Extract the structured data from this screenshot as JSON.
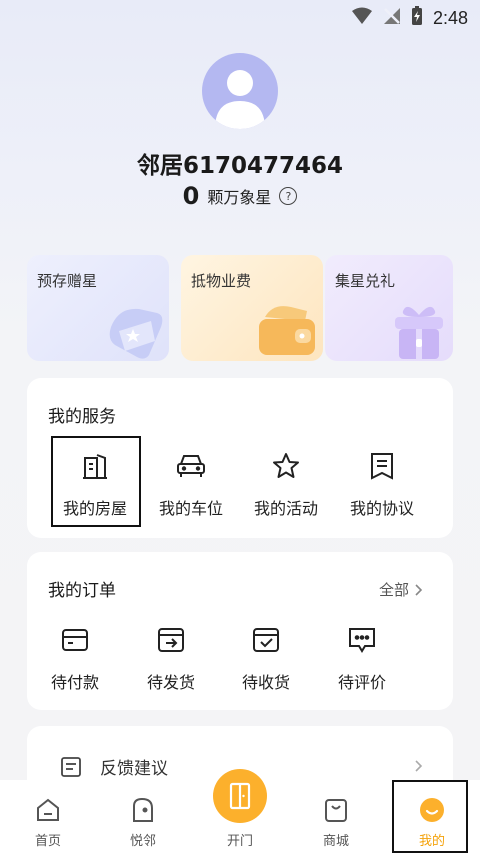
{
  "status": {
    "time": "2:48"
  },
  "profile": {
    "username": "邻居6170477464",
    "stars_count": "0",
    "stars_label": "颗万象星",
    "help_glyph": "?"
  },
  "cards": [
    {
      "label": "预存赠星",
      "icon": "wallet-star-icon"
    },
    {
      "label": "抵物业费",
      "icon": "wallet-icon"
    },
    {
      "label": "集星兑礼",
      "icon": "gift-icon"
    }
  ],
  "services": {
    "title": "我的服务",
    "items": [
      {
        "label": "我的房屋",
        "icon": "building-icon"
      },
      {
        "label": "我的车位",
        "icon": "car-icon"
      },
      {
        "label": "我的活动",
        "icon": "star-icon"
      },
      {
        "label": "我的协议",
        "icon": "document-icon"
      }
    ]
  },
  "orders": {
    "title": "我的订单",
    "all_label": "全部",
    "items": [
      {
        "label": "待付款",
        "icon": "card-icon"
      },
      {
        "label": "待发货",
        "icon": "ship-icon"
      },
      {
        "label": "待收货",
        "icon": "receive-icon"
      },
      {
        "label": "待评价",
        "icon": "comment-icon"
      }
    ]
  },
  "feedback": {
    "label": "反馈建议"
  },
  "tabbar": {
    "items": [
      {
        "label": "首页",
        "icon": "home-icon"
      },
      {
        "label": "悦邻",
        "icon": "neighbor-icon"
      },
      {
        "label": "开门",
        "icon": "door-icon"
      },
      {
        "label": "商城",
        "icon": "shop-icon"
      },
      {
        "label": "我的",
        "icon": "profile-icon"
      }
    ],
    "accent": "#fcb02c"
  }
}
